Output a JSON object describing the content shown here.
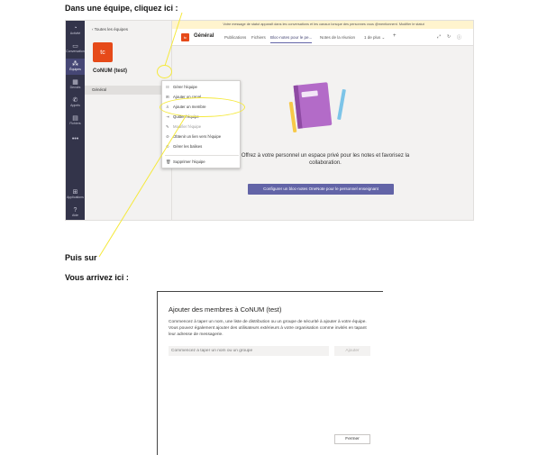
{
  "captions": {
    "step1": "Dans une équipe, cliquez ici :",
    "step2": "Puis sur",
    "step3": "Vous arrivez ici :"
  },
  "teams": {
    "rail": [
      {
        "icon": "bell-icon",
        "glyph": "◔",
        "label": "Activité"
      },
      {
        "icon": "chat-icon",
        "glyph": "▭",
        "label": "Conversation"
      },
      {
        "icon": "teams-icon",
        "glyph": "⁂",
        "label": "Équipes"
      },
      {
        "icon": "calendar-icon",
        "glyph": "▦",
        "label": "Devoirs"
      },
      {
        "icon": "phone-icon",
        "glyph": "✆",
        "label": "Appels"
      },
      {
        "icon": "files-icon",
        "glyph": "▤",
        "label": "Fichiers"
      },
      {
        "icon": "more-icon",
        "glyph": "•••",
        "label": ""
      },
      {
        "icon": "apps-icon",
        "glyph": "⊞",
        "label": "Applications"
      },
      {
        "icon": "help-icon",
        "glyph": "?",
        "label": "Aide"
      }
    ],
    "back_label": "‹  Toutes les équipes",
    "team_initials": "tc",
    "team_name": "CoNUM (test)",
    "more_label": "···",
    "channel": "Général",
    "notice": "Votre message de statut apparaît dans les conversations et les canaux lorsque des personnes vous @mentionnent. Modifier le statut",
    "header": {
      "channel_icon_text": "tc",
      "channel_name": "Général",
      "tabs": [
        "Publications",
        "Fichiers",
        "Bloc-notes pour le pe...",
        "Notes de la réunion",
        "1 de plus ⌄",
        "+"
      ],
      "active_tab": 2,
      "icons": [
        "⤢",
        "↻",
        "ⓘ"
      ]
    },
    "empty_text": "Offrez à votre personnel un espace privé pour les notes et favorisez la collaboration.",
    "configure_button": "Configurer un bloc-notes OneNote pour le personnel enseignant",
    "menu": [
      {
        "icon": "☷",
        "label": "Gérer l'équipe",
        "dim": false
      },
      {
        "icon": "⊞",
        "label": "Ajouter un canal",
        "dim": false
      },
      {
        "icon": "♙",
        "label": "Ajouter un membre",
        "dim": false
      },
      {
        "icon": "⇥",
        "label": "Quitter l'équipe",
        "dim": false
      },
      {
        "icon": "✎",
        "label": "Modifier l'équipe",
        "dim": true
      },
      {
        "icon": "⊘",
        "label": "Obtenir un lien vers l'équipe",
        "dim": false
      },
      {
        "icon": "⊙",
        "label": "Gérer les balises",
        "dim": false
      },
      {
        "icon": "🗑",
        "label": "Supprimer l'équipe",
        "dim": false
      }
    ]
  },
  "dialog": {
    "title": "Ajouter des membres à CoNUM (test)",
    "description": "Commencez à taper un nom, une liste de distribution ou un groupe de sécurité à ajouter à votre équipe. Vous pouvez également ajouter des utilisateurs extérieurs à votre organisation comme invités en tapant leur adresse de messagerie.",
    "input_placeholder": "Commencez à taper un nom ou un groupe",
    "add_button": "Ajouter",
    "close_button": "Fermer"
  }
}
